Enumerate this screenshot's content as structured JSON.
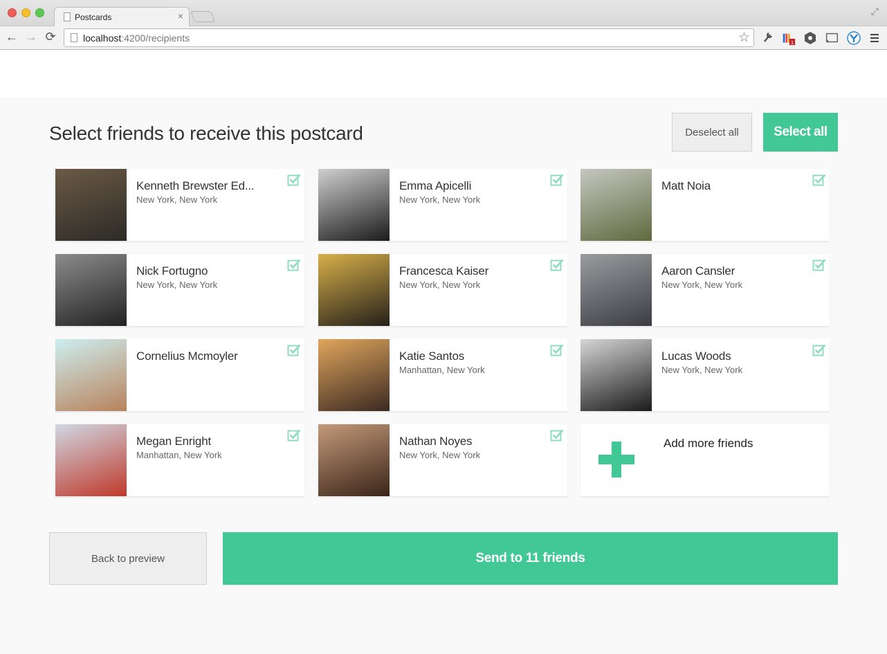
{
  "browser": {
    "tab_title": "Postcards",
    "tab_close": "×",
    "url_host": "localhost",
    "url_rest": ":4200/recipients",
    "back": "←",
    "forward": "→",
    "reload": "⟳",
    "star": "☆"
  },
  "page": {
    "title": "Select friends to receive this postcard",
    "deselect_all": "Deselect all",
    "select_all": "Select all",
    "add_more": "Add more friends",
    "back_to_preview": "Back to preview",
    "send": "Send to 11 friends"
  },
  "friends": [
    {
      "name": "Kenneth Brewster Ed...",
      "location": "New York, New York",
      "selected": true,
      "photo_colors": [
        "#6b5a46",
        "#2c2a26"
      ]
    },
    {
      "name": "Emma Apicelli",
      "location": "New York, New York",
      "selected": true,
      "photo_colors": [
        "#cfcfcf",
        "#1b1b1b"
      ]
    },
    {
      "name": "Matt Noia",
      "location": "",
      "selected": true,
      "photo_colors": [
        "#c5c7c0",
        "#5e6a3e"
      ]
    },
    {
      "name": "Nick Fortugno",
      "location": "New York, New York",
      "selected": true,
      "photo_colors": [
        "#8c8c8c",
        "#222222"
      ]
    },
    {
      "name": "Francesca Kaiser",
      "location": "New York, New York",
      "selected": true,
      "photo_colors": [
        "#d8b04a",
        "#24201a"
      ]
    },
    {
      "name": "Aaron Cansler",
      "location": "New York, New York",
      "selected": true,
      "photo_colors": [
        "#9a9ca0",
        "#3b3d42"
      ]
    },
    {
      "name": "Cornelius Mcmoyler",
      "location": "",
      "selected": true,
      "photo_colors": [
        "#cdeef0",
        "#b8825b"
      ]
    },
    {
      "name": "Katie Santos",
      "location": "Manhattan, New York",
      "selected": true,
      "photo_colors": [
        "#e0a55c",
        "#3b2a22"
      ]
    },
    {
      "name": "Lucas Woods",
      "location": "New York, New York",
      "selected": true,
      "photo_colors": [
        "#d6d6d6",
        "#1a1a1a"
      ]
    },
    {
      "name": "Megan Enright",
      "location": "Manhattan, New York",
      "selected": true,
      "photo_colors": [
        "#cfd8e3",
        "#c0392b"
      ]
    },
    {
      "name": "Nathan Noyes",
      "location": "New York, New York",
      "selected": true,
      "photo_colors": [
        "#c49a7a",
        "#3a2418"
      ]
    }
  ],
  "colors": {
    "accent": "#41c896",
    "check": "#8fdcbf"
  },
  "icons": {
    "check": "checkbox-checked-icon",
    "add": "plus-icon"
  }
}
